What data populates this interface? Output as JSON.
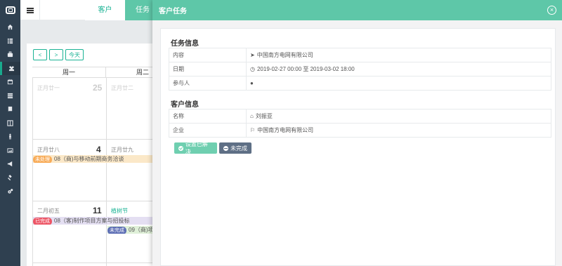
{
  "topbar": {
    "tabs": [
      {
        "label": "客户"
      },
      {
        "label": "任务"
      }
    ]
  },
  "sidebar": {
    "items": [
      {
        "icon": "home-icon"
      },
      {
        "icon": "list-icon"
      },
      {
        "icon": "briefcase-icon"
      },
      {
        "icon": "users-icon",
        "active": true
      },
      {
        "icon": "calendar-icon"
      },
      {
        "icon": "table-icon"
      },
      {
        "icon": "book-icon"
      },
      {
        "icon": "columns-icon"
      },
      {
        "icon": "person-icon"
      },
      {
        "icon": "image-icon"
      },
      {
        "icon": "megaphone-icon"
      },
      {
        "icon": "gavel-icon"
      },
      {
        "icon": "gears-icon"
      }
    ]
  },
  "calendar": {
    "prev": "<",
    "next": ">",
    "today": "今天",
    "weekdays": [
      "周一",
      "周二"
    ],
    "cells": {
      "r1c1_lunar": "正月廿一",
      "r1c1_day": "25",
      "r1c2_lunar": "正月廿二",
      "r2c1_lunar": "正月廿八",
      "r2c1_day": "4",
      "r2c2_lunar": "正月廿九",
      "r3c1_lunar": "二月初五",
      "r3c1_day": "11",
      "r3c2_lunar": "植树节"
    },
    "events": [
      {
        "badge": "未处理",
        "text": "08（商)与移动前期商务洽谈"
      },
      {
        "badge": "已完成",
        "text": "08（客)制作项目方案与招投标"
      },
      {
        "badge": "未完成",
        "text": "09（商)项"
      }
    ]
  },
  "modal": {
    "title": "客户任务",
    "close": "×",
    "task_section": "任务信息",
    "task_rows": [
      {
        "key": "内容",
        "icon": "location-arrow-icon",
        "value": "中国南方电网有限公司"
      },
      {
        "key": "日期",
        "value": "2019-02-27 00:00 至 2019-03-02 18:00"
      },
      {
        "key": "参与人",
        "icon": "user-icon",
        "value": ""
      }
    ],
    "customer_section": "客户信息",
    "customer_rows": [
      {
        "key": "名称",
        "icon": "home-icon",
        "value": "刘振亚"
      },
      {
        "key": "企业",
        "icon": "flag-icon",
        "value": "中国南方电网有限公司"
      }
    ],
    "buttons": {
      "resolve": "设置已解决",
      "unfinished": "未完成"
    }
  },
  "colors": {
    "accent": "#1ab394",
    "header": "#5ec7a8",
    "sidebar": "#2f4050",
    "badge_pending": "#f8ac59",
    "badge_done": "#ed5565",
    "badge_undone": "#5e6fb5"
  }
}
